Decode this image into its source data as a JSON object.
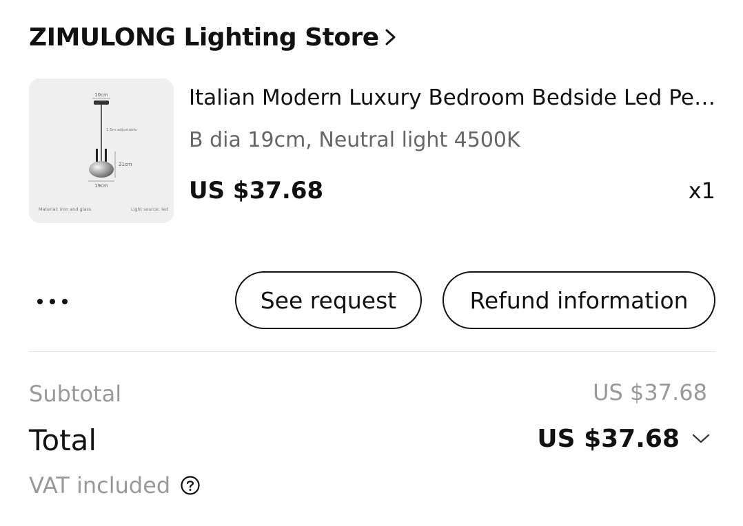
{
  "store": {
    "name": "ZIMULONG Lighting Store",
    "chevron_icon": "chevron-right-icon"
  },
  "product": {
    "title": "Italian Modern Luxury Bedroom Bedside Led Pendant Light",
    "variant": "B dia 19cm, Neutral light 4500K",
    "price": "US $37.68",
    "quantity": "x1",
    "image": {
      "label_top": "10cm",
      "label_cord": "1.5m adjustable",
      "label_height": "21cm",
      "label_width": "19cm",
      "label_material": "Material: iron and glass",
      "label_light": "Light source: led"
    }
  },
  "actions": {
    "more_icon": "more-horizontal-icon",
    "see_request": "See request",
    "refund_information": "Refund information"
  },
  "summary": {
    "subtotal_label": "Subtotal",
    "subtotal_value": "US $37.68",
    "total_label": "Total",
    "total_value": "US $37.68",
    "total_chevron_icon": "chevron-down-icon",
    "vat_label": "VAT included",
    "vat_help_icon": "help-circle-icon"
  }
}
